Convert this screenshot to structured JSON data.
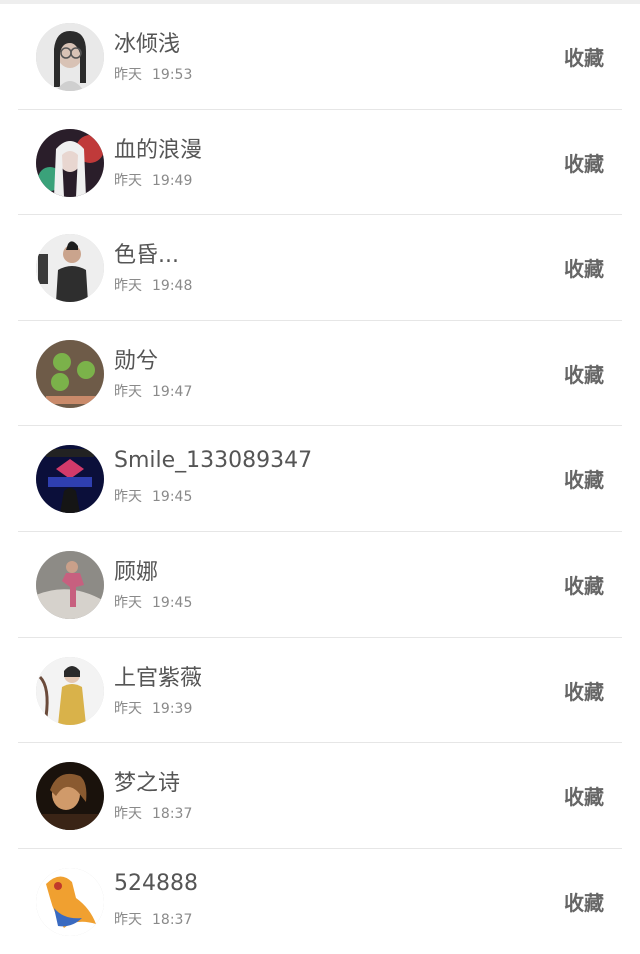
{
  "list": {
    "items": [
      {
        "name": "冰倾浅",
        "day": "昨天",
        "time": "19:53",
        "action": "收藏",
        "avatar_colors": [
          "#e9e9e9",
          "#2b2b2b",
          "#d8c2b5"
        ]
      },
      {
        "name": "血的浪漫",
        "day": "昨天",
        "time": "19:49",
        "action": "收藏",
        "avatar_colors": [
          "#2a1e2a",
          "#c03a3a",
          "#3aa27a"
        ]
      },
      {
        "name": "色昏...",
        "day": "昨天",
        "time": "19:48",
        "action": "收藏",
        "avatar_colors": [
          "#eeeeee",
          "#2e2e2e",
          "#caa48d"
        ]
      },
      {
        "name": "勋兮",
        "day": "昨天",
        "time": "19:47",
        "action": "收藏",
        "avatar_colors": [
          "#6e5b48",
          "#7bb24a",
          "#c98a6a"
        ]
      },
      {
        "name": "Smile_133089347",
        "day": "昨天",
        "time": "19:45",
        "action": "收藏",
        "avatar_colors": [
          "#0b0f3a",
          "#2f3fb0",
          "#d23a6a"
        ]
      },
      {
        "name": "顾娜",
        "day": "昨天",
        "time": "19:45",
        "action": "收藏",
        "avatar_colors": [
          "#8d8b86",
          "#d6d2cc",
          "#c7607f"
        ]
      },
      {
        "name": "上官紫薇",
        "day": "昨天",
        "time": "19:39",
        "action": "收藏",
        "avatar_colors": [
          "#f3f3f3",
          "#d9b24a",
          "#2a2a2a"
        ]
      },
      {
        "name": "梦之诗",
        "day": "昨天",
        "time": "18:37",
        "action": "收藏",
        "avatar_colors": [
          "#1a120c",
          "#8a5a30",
          "#d09a6a"
        ]
      },
      {
        "name": "524888",
        "day": "昨天",
        "time": "18:37",
        "action": "收藏",
        "avatar_colors": [
          "#ffffff",
          "#f0a030",
          "#3a6ac0"
        ]
      }
    ]
  }
}
